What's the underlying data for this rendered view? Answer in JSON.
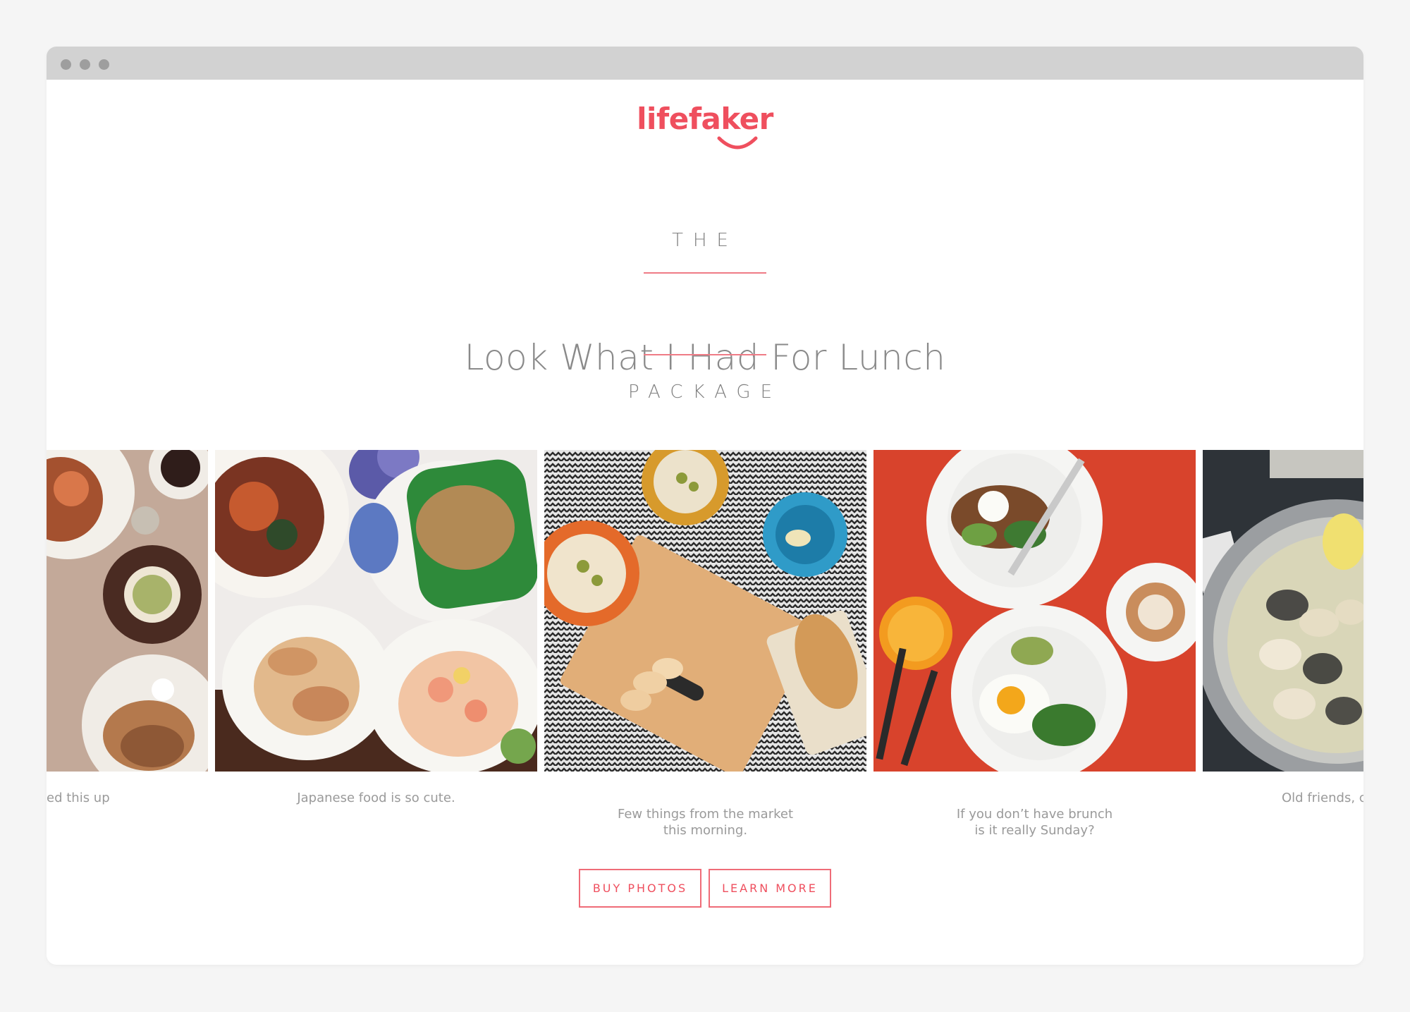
{
  "brand": {
    "logo_text": "lifefaker",
    "accent_color": "#ef4f5e"
  },
  "hero": {
    "kicker_top": "THE",
    "title": "Look What I Had For Lunch",
    "kicker_bottom": "PACKAGE"
  },
  "gallery": {
    "captions": [
      "ed this up",
      "Japanese food is so cute.",
      "Few things from the market\nthis morning.",
      "If you don’t have brunch\nis it really Sunday?",
      "Old friends, c"
    ]
  },
  "actions": {
    "buy_label": "BUY PHOTOS",
    "learn_label": "LEARN MORE"
  }
}
